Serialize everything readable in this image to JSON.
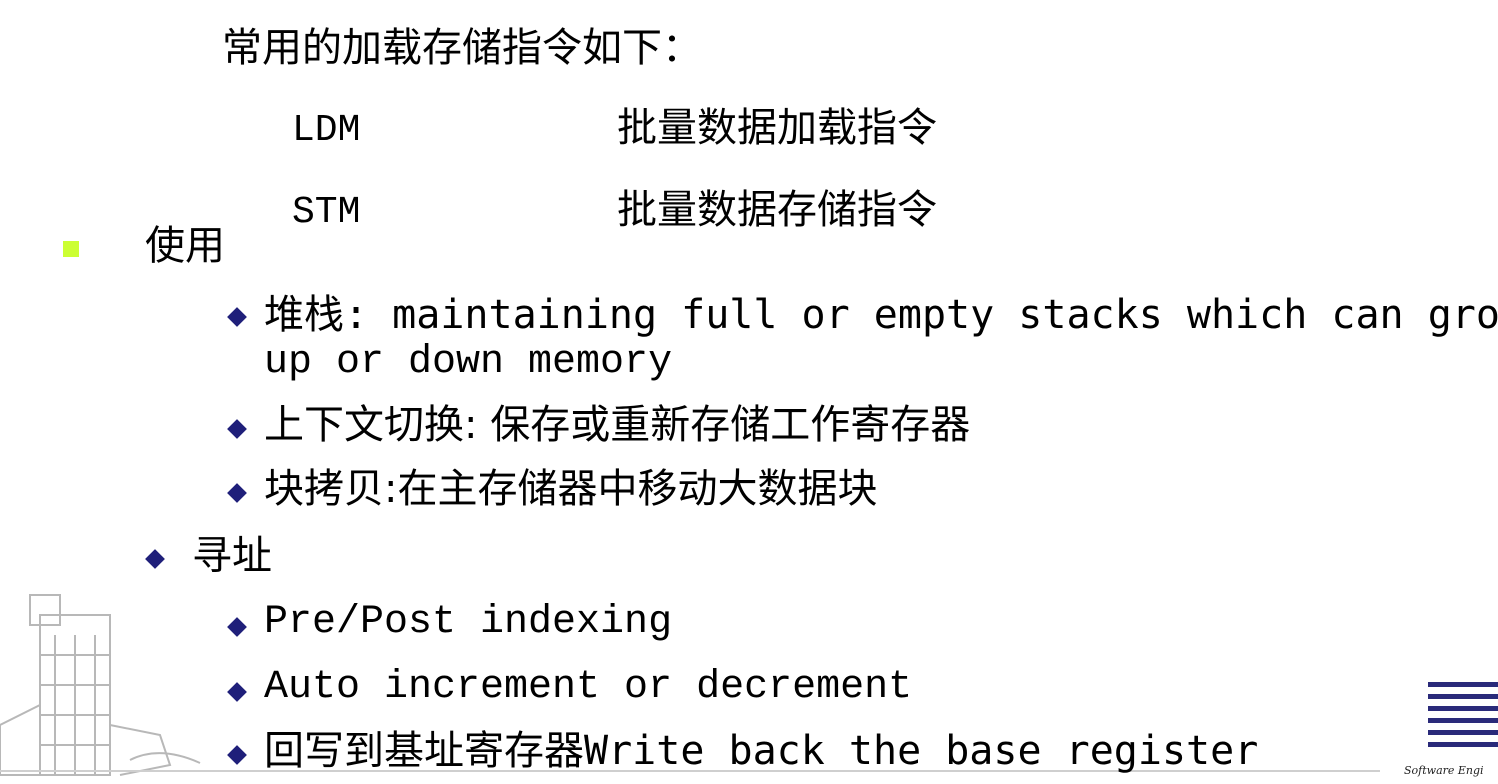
{
  "intro": "常用的加载存储指令如下：",
  "instructions": [
    {
      "mnemonic": "LDM",
      "description": "批量数据加载指令"
    },
    {
      "mnemonic": "STM",
      "description": "批量数据存储指令"
    }
  ],
  "usage": {
    "label": "使用",
    "stack_line1": "堆栈: maintaining full or empty stacks which can grow",
    "stack_line2": "up or down memory",
    "context_switch": "上下文切换: 保存或重新存储工作寄存器",
    "block_copy": "块拷贝:在主存储器中移动大数据块"
  },
  "addressing": {
    "label": "寻址",
    "pre_post": "Pre/Post indexing",
    "auto": "Auto increment or decrement",
    "writeback": "回写到基址寄存器Write back the base register"
  },
  "logo_text": "Software Engi",
  "colors": {
    "square_bullet": "#ccff33",
    "diamond_bullet": "#1f1f7a"
  }
}
